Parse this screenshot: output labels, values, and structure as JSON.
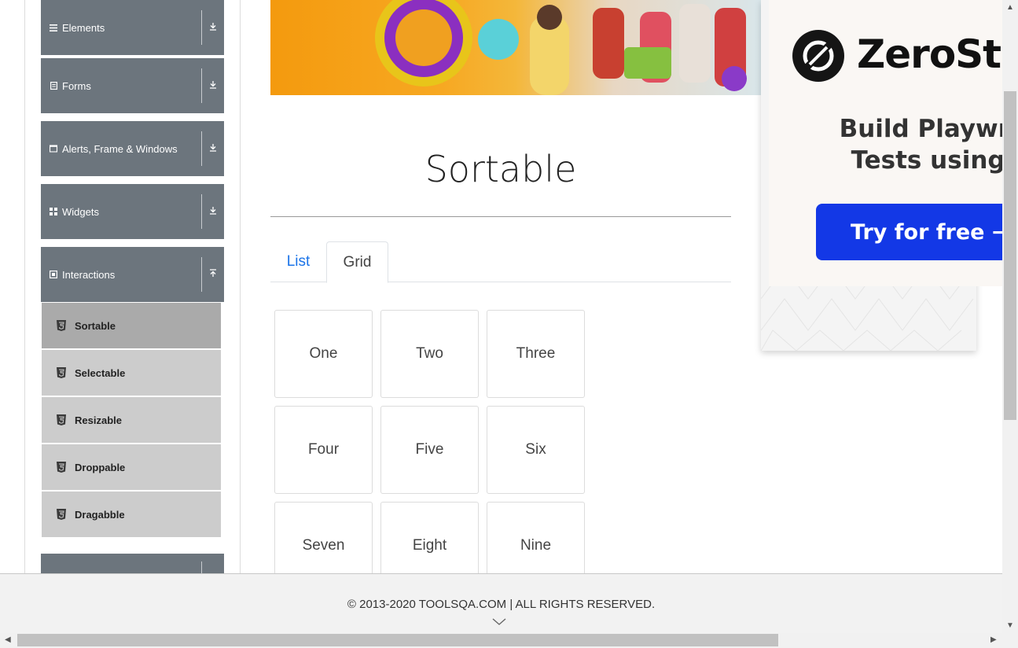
{
  "sidebar": {
    "groups": [
      {
        "label": "Elements",
        "icon": "list-icon",
        "arrow": "download-arrow-icon"
      },
      {
        "label": "Forms",
        "icon": "document-icon",
        "arrow": "download-arrow-icon"
      },
      {
        "label": "Alerts, Frame & Windows",
        "icon": "window-icon",
        "arrow": "download-arrow-icon"
      },
      {
        "label": "Widgets",
        "icon": "grid-icon",
        "arrow": "download-arrow-icon"
      },
      {
        "label": "Interactions",
        "icon": "box-icon",
        "arrow": "upload-arrow-icon"
      }
    ],
    "items": [
      {
        "label": "Sortable",
        "active": true
      },
      {
        "label": "Selectable"
      },
      {
        "label": "Resizable"
      },
      {
        "label": "Droppable"
      },
      {
        "label": "Dragabble"
      }
    ]
  },
  "main": {
    "title": "Sortable",
    "tabs": [
      {
        "label": "List",
        "active": false
      },
      {
        "label": "Grid",
        "active": true
      }
    ],
    "grid_items": [
      "One",
      "Two",
      "Three",
      "Four",
      "Five",
      "Six",
      "Seven",
      "Eight",
      "Nine"
    ]
  },
  "ad": {
    "brand": "ZeroSte",
    "headline_line1": "Build Playwrigl",
    "headline_line2": "Tests using A",
    "cta": "Try for free →"
  },
  "footer": {
    "text": "© 2013-2020 TOOLSQA.COM | ALL RIGHTS RESERVED."
  },
  "colors": {
    "sidebar_header": "#6c757d",
    "sidebar_item": "#cccccc",
    "sidebar_item_active": "#aaaaaa",
    "link_blue": "#1a73e8",
    "cta_blue": "#1338e6"
  }
}
